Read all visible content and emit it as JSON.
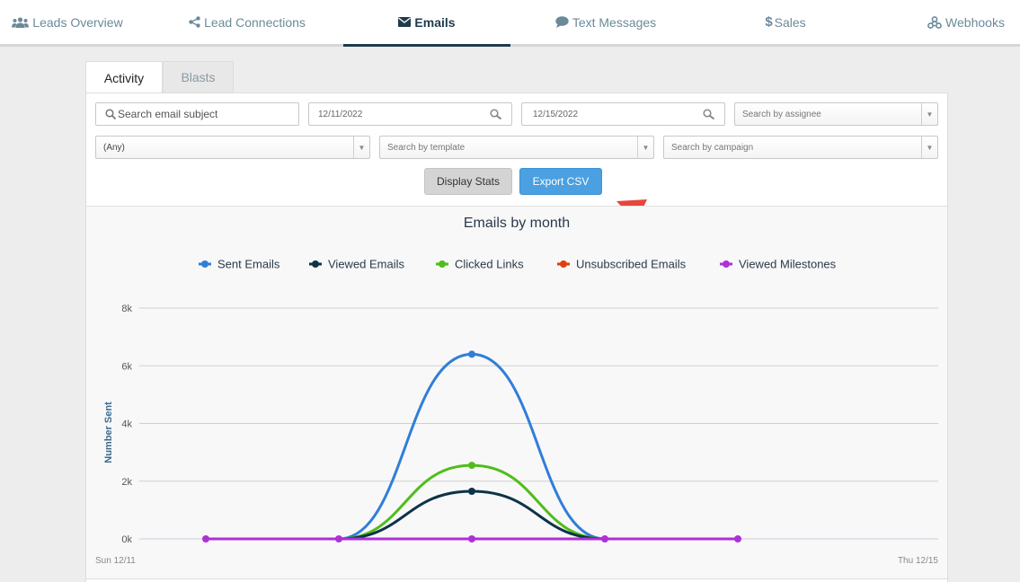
{
  "nav": {
    "items": [
      {
        "label": "Leads Overview",
        "icon": "users-icon"
      },
      {
        "label": "Lead Connections",
        "icon": "share-icon"
      },
      {
        "label": "Emails",
        "icon": "envelope-icon"
      },
      {
        "label": "Text Messages",
        "icon": "chat-bubble-icon"
      },
      {
        "label": "Sales",
        "icon": "dollar-icon"
      },
      {
        "label": "Webhooks",
        "icon": "webhook-icon"
      }
    ],
    "active": "Emails"
  },
  "tabs": {
    "activity": "Activity",
    "blasts": "Blasts"
  },
  "filters": {
    "subject_placeholder": "Search email subject",
    "start_date": "12/11/2022",
    "end_date": "12/15/2022",
    "assignee_placeholder": "Search by assignee",
    "status_value": "(Any)",
    "template_placeholder": "Search by template",
    "campaign_placeholder": "Search by campaign"
  },
  "buttons": {
    "display_stats": "Display Stats",
    "export_csv": "Export CSV"
  },
  "annotation": {
    "arrow_color": "#e8453c"
  },
  "chart_data": {
    "type": "line",
    "title": "Emails by month",
    "ylabel": "Number Sent",
    "xlabel": "",
    "ylim": [
      0,
      8000
    ],
    "yticks": [
      "0k",
      "2k",
      "4k",
      "6k",
      "8k"
    ],
    "x_edge_labels": [
      "Sun 12/11",
      "Thu 12/15"
    ],
    "legend_position": "top",
    "series": [
      {
        "name": "Sent Emails",
        "color": "#2f7ed8",
        "values": [
          0,
          0,
          6400,
          0,
          0
        ]
      },
      {
        "name": "Viewed Emails",
        "color": "#0d3349",
        "values": [
          0,
          0,
          1650,
          0,
          0
        ]
      },
      {
        "name": "Clicked Links",
        "color": "#4fbd1a",
        "values": [
          0,
          0,
          2550,
          0,
          0
        ]
      },
      {
        "name": "Unsubscribed Emails",
        "color": "#e0400a",
        "values": [
          0,
          0,
          0,
          0,
          0
        ]
      },
      {
        "name": "Viewed Milestones",
        "color": "#b02fd8",
        "values": [
          0,
          0,
          0,
          0,
          0
        ]
      }
    ]
  }
}
